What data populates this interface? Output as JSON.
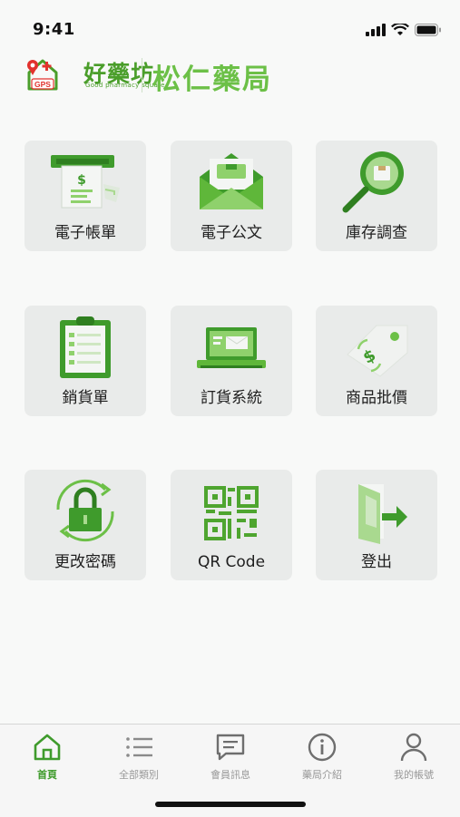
{
  "status": {
    "time": "9:41"
  },
  "header": {
    "brand_name": "好藥坊",
    "brand_sub": "Good pharmacy square",
    "brand_badge": "GPS",
    "store_name": "松仁藥局"
  },
  "colors": {
    "brand_green": "#4a9e2a",
    "accent_green": "#6cc047",
    "tile_bg": "#e9ebea"
  },
  "menu": [
    {
      "label": "電子帳單",
      "icon": "e-bill-icon"
    },
    {
      "label": "電子公文",
      "icon": "e-document-envelope-icon"
    },
    {
      "label": "庫存調查",
      "icon": "inventory-magnifier-icon"
    },
    {
      "label": "銷貨單",
      "icon": "sales-clipboard-icon"
    },
    {
      "label": "訂貨系統",
      "icon": "ordering-laptop-icon"
    },
    {
      "label": "商品批價",
      "icon": "price-tag-icon"
    },
    {
      "label": "更改密碼",
      "icon": "change-password-lock-icon"
    },
    {
      "label": "QR Code",
      "icon": "qr-code-icon"
    },
    {
      "label": "登出",
      "icon": "logout-door-icon"
    }
  ],
  "tabs": [
    {
      "label": "首頁",
      "icon": "home-icon",
      "active": true
    },
    {
      "label": "全部類別",
      "icon": "list-icon",
      "active": false
    },
    {
      "label": "會員訊息",
      "icon": "message-icon",
      "active": false
    },
    {
      "label": "藥局介紹",
      "icon": "info-icon",
      "active": false
    },
    {
      "label": "我的帳號",
      "icon": "user-icon",
      "active": false
    }
  ]
}
